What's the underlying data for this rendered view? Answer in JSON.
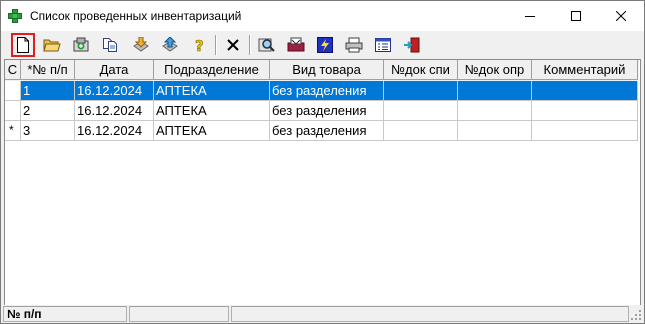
{
  "window": {
    "title": "Список проведенных инвентаризаций",
    "controls": [
      "minimize-icon",
      "maximize-icon",
      "close-icon"
    ]
  },
  "toolbar": {
    "buttons": [
      {
        "icon": "new-document-icon",
        "active": true
      },
      {
        "icon": "open-folder-icon"
      },
      {
        "icon": "add-record-icon"
      },
      {
        "icon": "copy-icon"
      },
      {
        "icon": "download-icon"
      },
      {
        "icon": "upload-icon"
      },
      {
        "icon": "help-icon"
      },
      {
        "icon": "delete-icon"
      },
      {
        "icon": "search-icon"
      },
      {
        "icon": "print-settings-icon"
      },
      {
        "icon": "lightning-icon"
      },
      {
        "icon": "printer-icon"
      },
      {
        "icon": "list-icon"
      },
      {
        "icon": "exit-door-icon"
      }
    ]
  },
  "grid": {
    "columns": [
      "С",
      "*№ п/п",
      "Дата",
      "Подразделение",
      "Вид товара",
      "№док спи",
      "№док опр",
      "Комментарий"
    ],
    "rows": [
      {
        "indicator": "",
        "num": "1",
        "date": "16.12.2024",
        "dept": "АПТЕКА",
        "kind": "без разделения",
        "doc1": "",
        "doc2": "",
        "comment": "",
        "selected": true
      },
      {
        "indicator": "",
        "num": "2",
        "date": "16.12.2024",
        "dept": "АПТЕКА",
        "kind": "без разделения",
        "doc1": "",
        "doc2": "",
        "comment": "",
        "selected": false
      },
      {
        "indicator": "*",
        "num": "3",
        "date": "16.12.2024",
        "dept": "АПТЕКА",
        "kind": "без разделения",
        "doc1": "",
        "doc2": "",
        "comment": "",
        "selected": false
      }
    ]
  },
  "status": {
    "panel1": "№ п/п",
    "panel2": "",
    "panel3": ""
  },
  "colors": {
    "selection": "#0078d7",
    "active_button_border": "#e02020"
  }
}
